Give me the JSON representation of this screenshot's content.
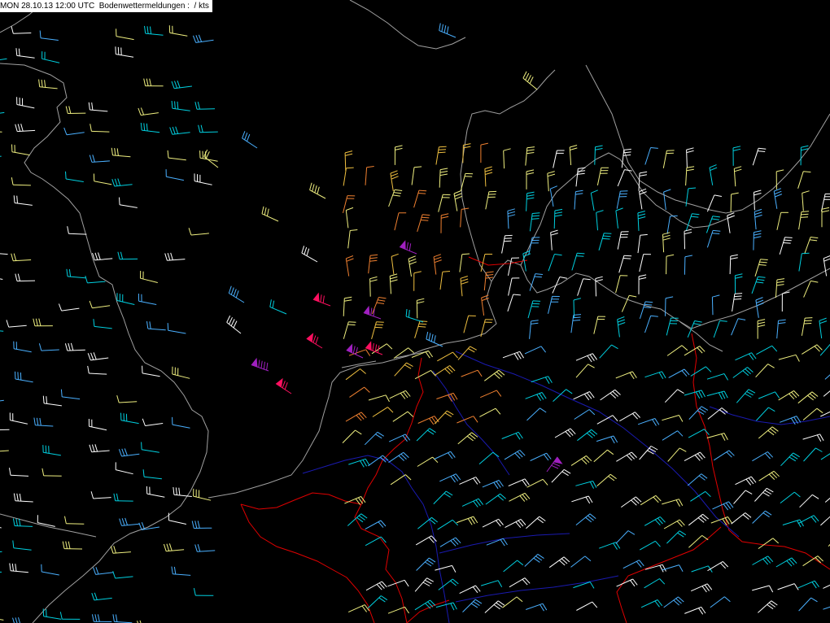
{
  "header": {
    "day": "MON",
    "date": "28.10.13",
    "time": "12:00 UTC",
    "product": "Bodenwettermeldungen :",
    "units": " / kts"
  },
  "map": {
    "background_color": "#000000",
    "coastline_color": "#a0a0a0",
    "border_color": "#e00000",
    "river_color": "#1a1ab0",
    "wind_color_scale": [
      "#4ab0ff",
      "#00d0e0",
      "#ffffff",
      "#f0f080",
      "#f0c040",
      "#f08030",
      "#e02020",
      "#ff1060",
      "#a020c0",
      "#30d030"
    ]
  }
}
